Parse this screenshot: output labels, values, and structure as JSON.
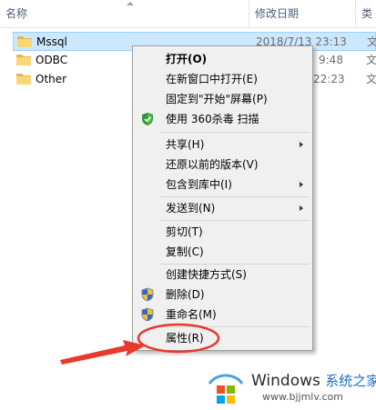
{
  "header": {
    "name": "名称",
    "date": "修改日期",
    "type": "类"
  },
  "files": [
    {
      "name": "Mssql",
      "date": "2018/7/13 23:13",
      "type": "文",
      "selected": true
    },
    {
      "name": "ODBC",
      "date": "9:48",
      "type": "文",
      "selected": false
    },
    {
      "name": "Other",
      "date": "22:23",
      "type": "文",
      "selected": false
    }
  ],
  "menu": {
    "items": [
      {
        "label": "打开(O)",
        "bold": true
      },
      {
        "label": "在新窗口中打开(E)"
      },
      {
        "label": "固定到\"开始\"屏幕(P)"
      },
      {
        "label": "使用 360杀毒 扫描",
        "icon": "360-shield-icon"
      },
      {
        "label": "共享(H)",
        "submenu": true
      },
      {
        "label": "还原以前的版本(V)"
      },
      {
        "label": "包含到库中(I)",
        "submenu": true
      },
      {
        "label": "发送到(N)",
        "submenu": true
      },
      {
        "label": "剪切(T)"
      },
      {
        "label": "复制(C)"
      },
      {
        "label": "创建快捷方式(S)"
      },
      {
        "label": "删除(D)",
        "icon": "uac-shield-icon"
      },
      {
        "label": "重命名(M)",
        "icon": "uac-shield-icon"
      },
      {
        "label": "属性(R)"
      }
    ]
  },
  "watermark": {
    "brand": "Windows",
    "brand_cn": "系统之家",
    "url": "www.bjjmlv.com"
  },
  "colors": {
    "selection": "#cce8ff",
    "selection_border": "#99d1ff",
    "annotation": "#e8392c",
    "menu_bg": "#f0f0f0"
  }
}
